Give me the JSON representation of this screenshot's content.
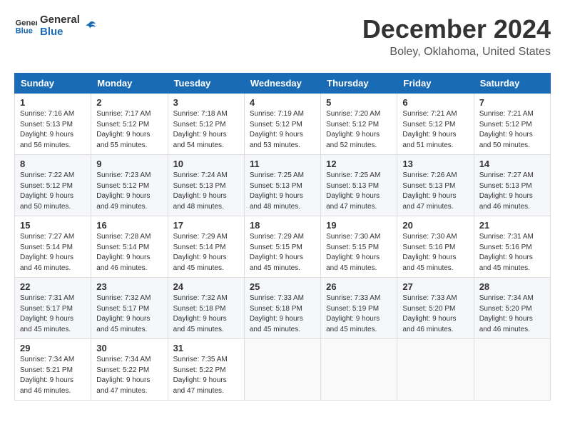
{
  "logo": {
    "line1": "General",
    "line2": "Blue"
  },
  "title": "December 2024",
  "subtitle": "Boley, Oklahoma, United States",
  "days_header": [
    "Sunday",
    "Monday",
    "Tuesday",
    "Wednesday",
    "Thursday",
    "Friday",
    "Saturday"
  ],
  "weeks": [
    [
      {
        "day": "1",
        "info": "Sunrise: 7:16 AM\nSunset: 5:13 PM\nDaylight: 9 hours\nand 56 minutes."
      },
      {
        "day": "2",
        "info": "Sunrise: 7:17 AM\nSunset: 5:12 PM\nDaylight: 9 hours\nand 55 minutes."
      },
      {
        "day": "3",
        "info": "Sunrise: 7:18 AM\nSunset: 5:12 PM\nDaylight: 9 hours\nand 54 minutes."
      },
      {
        "day": "4",
        "info": "Sunrise: 7:19 AM\nSunset: 5:12 PM\nDaylight: 9 hours\nand 53 minutes."
      },
      {
        "day": "5",
        "info": "Sunrise: 7:20 AM\nSunset: 5:12 PM\nDaylight: 9 hours\nand 52 minutes."
      },
      {
        "day": "6",
        "info": "Sunrise: 7:21 AM\nSunset: 5:12 PM\nDaylight: 9 hours\nand 51 minutes."
      },
      {
        "day": "7",
        "info": "Sunrise: 7:21 AM\nSunset: 5:12 PM\nDaylight: 9 hours\nand 50 minutes."
      }
    ],
    [
      {
        "day": "8",
        "info": "Sunrise: 7:22 AM\nSunset: 5:12 PM\nDaylight: 9 hours\nand 50 minutes."
      },
      {
        "day": "9",
        "info": "Sunrise: 7:23 AM\nSunset: 5:12 PM\nDaylight: 9 hours\nand 49 minutes."
      },
      {
        "day": "10",
        "info": "Sunrise: 7:24 AM\nSunset: 5:13 PM\nDaylight: 9 hours\nand 48 minutes."
      },
      {
        "day": "11",
        "info": "Sunrise: 7:25 AM\nSunset: 5:13 PM\nDaylight: 9 hours\nand 48 minutes."
      },
      {
        "day": "12",
        "info": "Sunrise: 7:25 AM\nSunset: 5:13 PM\nDaylight: 9 hours\nand 47 minutes."
      },
      {
        "day": "13",
        "info": "Sunrise: 7:26 AM\nSunset: 5:13 PM\nDaylight: 9 hours\nand 47 minutes."
      },
      {
        "day": "14",
        "info": "Sunrise: 7:27 AM\nSunset: 5:13 PM\nDaylight: 9 hours\nand 46 minutes."
      }
    ],
    [
      {
        "day": "15",
        "info": "Sunrise: 7:27 AM\nSunset: 5:14 PM\nDaylight: 9 hours\nand 46 minutes."
      },
      {
        "day": "16",
        "info": "Sunrise: 7:28 AM\nSunset: 5:14 PM\nDaylight: 9 hours\nand 46 minutes."
      },
      {
        "day": "17",
        "info": "Sunrise: 7:29 AM\nSunset: 5:14 PM\nDaylight: 9 hours\nand 45 minutes."
      },
      {
        "day": "18",
        "info": "Sunrise: 7:29 AM\nSunset: 5:15 PM\nDaylight: 9 hours\nand 45 minutes."
      },
      {
        "day": "19",
        "info": "Sunrise: 7:30 AM\nSunset: 5:15 PM\nDaylight: 9 hours\nand 45 minutes."
      },
      {
        "day": "20",
        "info": "Sunrise: 7:30 AM\nSunset: 5:16 PM\nDaylight: 9 hours\nand 45 minutes."
      },
      {
        "day": "21",
        "info": "Sunrise: 7:31 AM\nSunset: 5:16 PM\nDaylight: 9 hours\nand 45 minutes."
      }
    ],
    [
      {
        "day": "22",
        "info": "Sunrise: 7:31 AM\nSunset: 5:17 PM\nDaylight: 9 hours\nand 45 minutes."
      },
      {
        "day": "23",
        "info": "Sunrise: 7:32 AM\nSunset: 5:17 PM\nDaylight: 9 hours\nand 45 minutes."
      },
      {
        "day": "24",
        "info": "Sunrise: 7:32 AM\nSunset: 5:18 PM\nDaylight: 9 hours\nand 45 minutes."
      },
      {
        "day": "25",
        "info": "Sunrise: 7:33 AM\nSunset: 5:18 PM\nDaylight: 9 hours\nand 45 minutes."
      },
      {
        "day": "26",
        "info": "Sunrise: 7:33 AM\nSunset: 5:19 PM\nDaylight: 9 hours\nand 45 minutes."
      },
      {
        "day": "27",
        "info": "Sunrise: 7:33 AM\nSunset: 5:20 PM\nDaylight: 9 hours\nand 46 minutes."
      },
      {
        "day": "28",
        "info": "Sunrise: 7:34 AM\nSunset: 5:20 PM\nDaylight: 9 hours\nand 46 minutes."
      }
    ],
    [
      {
        "day": "29",
        "info": "Sunrise: 7:34 AM\nSunset: 5:21 PM\nDaylight: 9 hours\nand 46 minutes."
      },
      {
        "day": "30",
        "info": "Sunrise: 7:34 AM\nSunset: 5:22 PM\nDaylight: 9 hours\nand 47 minutes."
      },
      {
        "day": "31",
        "info": "Sunrise: 7:35 AM\nSunset: 5:22 PM\nDaylight: 9 hours\nand 47 minutes."
      },
      {
        "day": "",
        "info": ""
      },
      {
        "day": "",
        "info": ""
      },
      {
        "day": "",
        "info": ""
      },
      {
        "day": "",
        "info": ""
      }
    ]
  ]
}
